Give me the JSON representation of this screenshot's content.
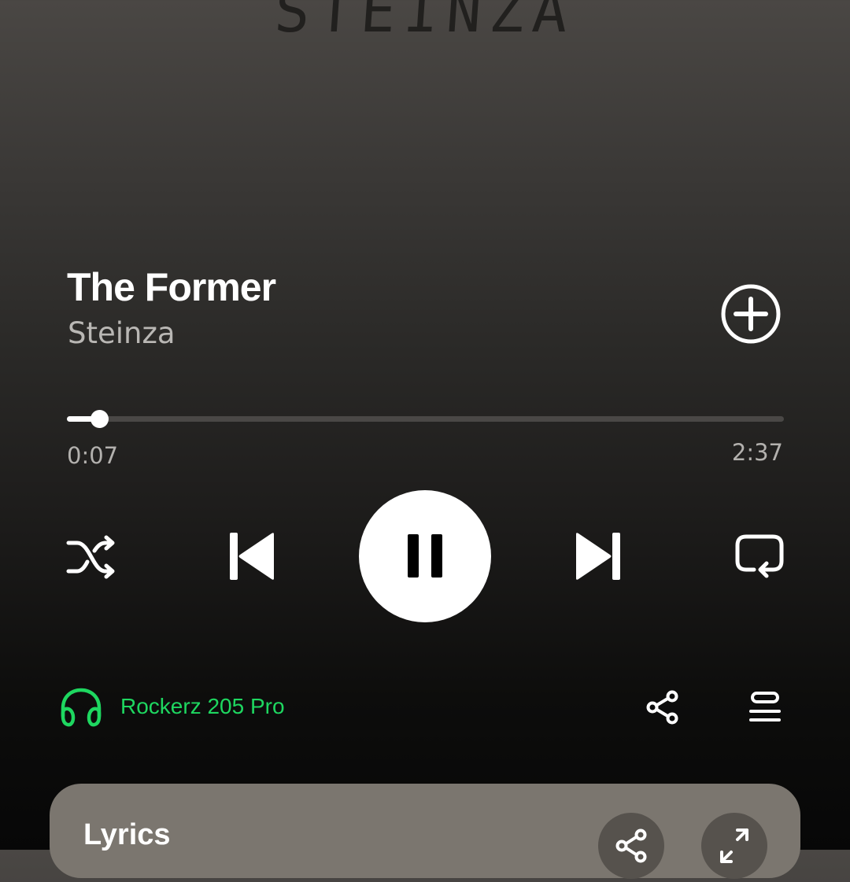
{
  "artwork": {
    "text": "STEINZA"
  },
  "track": {
    "title": "The Former",
    "artist": "Steinza"
  },
  "progress": {
    "elapsed": "0:07",
    "total": "2:37",
    "fraction": 0.045
  },
  "controls": {
    "shuffle": "shuffle-icon",
    "previous": "skip-previous-icon",
    "play_pause": "pause-icon",
    "next": "skip-next-icon",
    "repeat": "repeat-icon"
  },
  "device": {
    "name": "Rockerz 205 Pro",
    "icon": "headphones-icon",
    "color": "#1ed760"
  },
  "actions": {
    "share": "share-icon",
    "queue": "queue-icon",
    "add": "add-circle-icon"
  },
  "lyrics": {
    "title": "Lyrics",
    "share": "share-icon",
    "expand": "expand-icon",
    "card_color": "#7b766f"
  }
}
